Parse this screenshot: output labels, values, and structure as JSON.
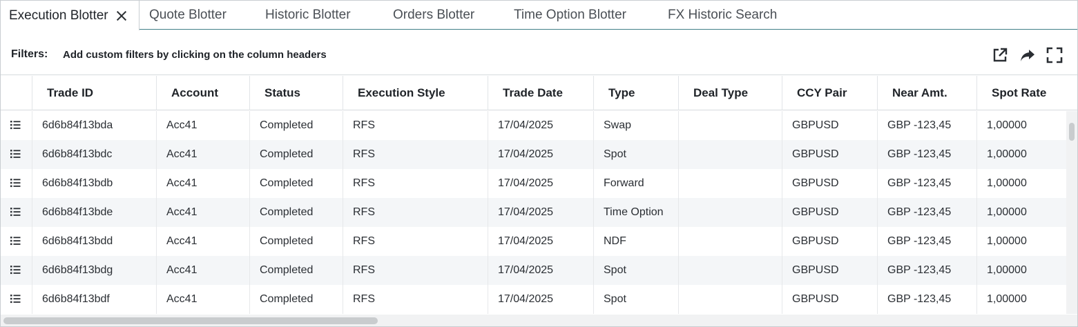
{
  "tabs": [
    {
      "label": "Execution Blotter",
      "active": true,
      "closable": true
    },
    {
      "label": "Quote Blotter"
    },
    {
      "label": "Historic Blotter"
    },
    {
      "label": "Orders Blotter"
    },
    {
      "label": "Time Option Blotter"
    },
    {
      "label": "FX Historic Search"
    }
  ],
  "filters": {
    "label": "Filters:",
    "hint": "Add custom filters by clicking on the column headers",
    "icons": [
      "open-external-icon",
      "share-icon",
      "fullscreen-icon"
    ]
  },
  "columns": [
    "Trade ID",
    "Account",
    "Status",
    "Execution Style",
    "Trade Date",
    "Type",
    "Deal Type",
    "CCY Pair",
    "Near Amt.",
    "Spot Rate"
  ],
  "rows": [
    [
      "6d6b84f13bda",
      "Acc41",
      "Completed",
      "RFS",
      "17/04/2025",
      "Swap",
      "",
      "GBPUSD",
      "GBP -123,45",
      "1,00000"
    ],
    [
      "6d6b84f13bdc",
      "Acc41",
      "Completed",
      "RFS",
      "17/04/2025",
      "Spot",
      "",
      "GBPUSD",
      "GBP -123,45",
      "1,00000"
    ],
    [
      "6d6b84f13bdb",
      "Acc41",
      "Completed",
      "RFS",
      "17/04/2025",
      "Forward",
      "",
      "GBPUSD",
      "GBP -123,45",
      "1,00000"
    ],
    [
      "6d6b84f13bde",
      "Acc41",
      "Completed",
      "RFS",
      "17/04/2025",
      "Time Option",
      "",
      "GBPUSD",
      "GBP -123,45",
      "1,00000"
    ],
    [
      "6d6b84f13bdd",
      "Acc41",
      "Completed",
      "RFS",
      "17/04/2025",
      "NDF",
      "",
      "GBPUSD",
      "GBP -123,45",
      "1,00000"
    ],
    [
      "6d6b84f13bdg",
      "Acc41",
      "Completed",
      "RFS",
      "17/04/2025",
      "Spot",
      "",
      "GBPUSD",
      "GBP -123,45",
      "1,00000"
    ],
    [
      "6d6b84f13bdf",
      "Acc41",
      "Completed",
      "RFS",
      "17/04/2025",
      "Spot",
      "",
      "GBPUSD",
      "GBP -123,45",
      "1,00000"
    ]
  ],
  "row_icon": "row-menu-icon",
  "colors": {
    "accent_line": "#3f7f86",
    "row_alt": "#f4f6f8"
  }
}
